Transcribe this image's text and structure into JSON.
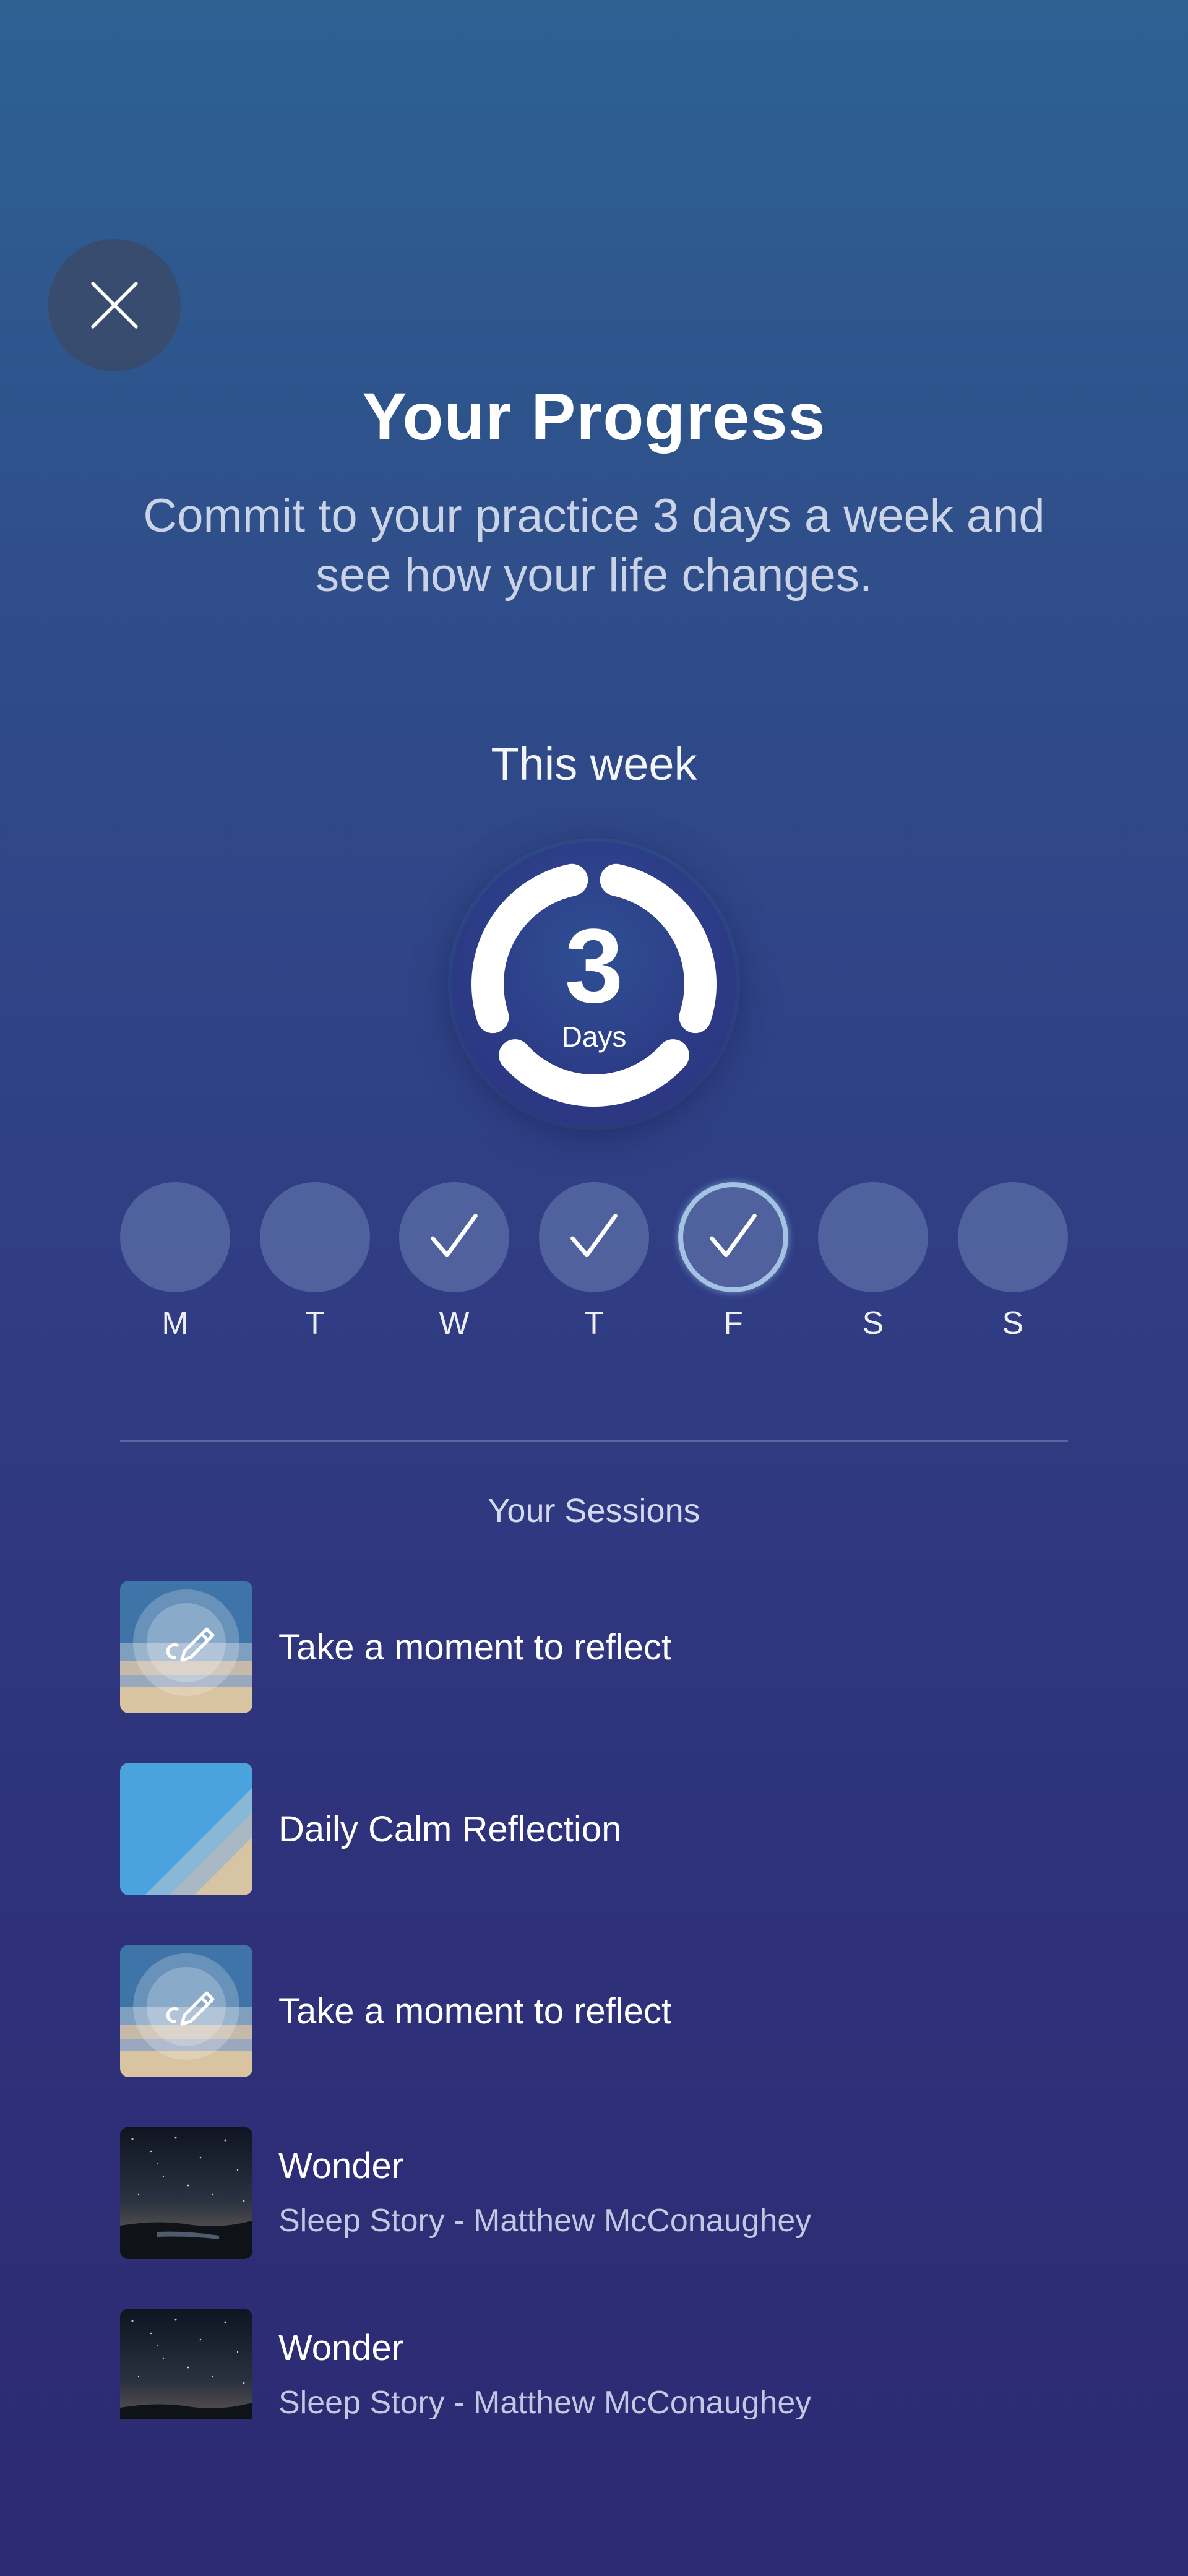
{
  "header": {
    "close_icon": "close-icon",
    "title": "Your Progress",
    "subtitle": "Commit to your practice 3 days a week and see how your life changes."
  },
  "week": {
    "label": "This week",
    "days_count": "3",
    "days_unit": "Days",
    "goal_days": 3,
    "days": [
      {
        "label": "M",
        "checked": false,
        "today": false
      },
      {
        "label": "T",
        "checked": false,
        "today": false
      },
      {
        "label": "W",
        "checked": true,
        "today": false
      },
      {
        "label": "T",
        "checked": true,
        "today": false
      },
      {
        "label": "F",
        "checked": true,
        "today": true
      },
      {
        "label": "S",
        "checked": false,
        "today": false
      },
      {
        "label": "S",
        "checked": false,
        "today": false
      }
    ]
  },
  "sessions": {
    "heading": "Your Sessions",
    "items": [
      {
        "title": "Take a moment to reflect",
        "subtitle": "",
        "thumb": "reflect-pencil-icon"
      },
      {
        "title": "Daily Calm Reflection",
        "subtitle": "",
        "thumb": "beach-stripes"
      },
      {
        "title": "Take a moment to reflect",
        "subtitle": "",
        "thumb": "reflect-pencil-icon"
      },
      {
        "title": "Wonder",
        "subtitle": "Sleep Story - Matthew McConaughey",
        "thumb": "starry-night"
      },
      {
        "title": "Wonder",
        "subtitle": "Sleep Story - Matthew McConaughey",
        "thumb": "starry-night"
      }
    ]
  },
  "colors": {
    "bg_top": "#2d6293",
    "bg_bottom": "#2c2a72",
    "ring": "#ffffff",
    "day_inactive": "#5a6fa0"
  }
}
